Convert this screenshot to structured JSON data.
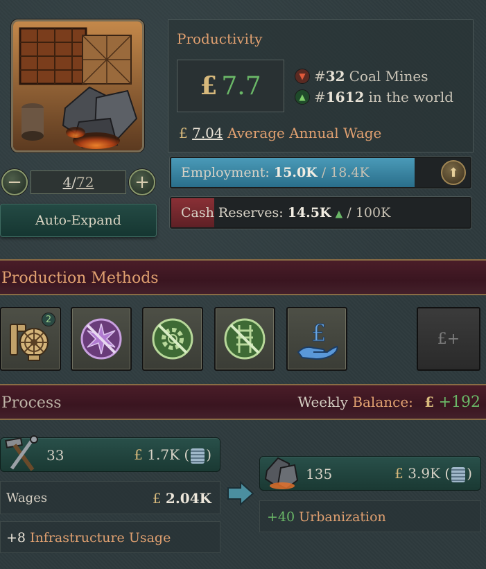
{
  "building": {
    "level_current": "4",
    "level_max": "72",
    "auto_expand_label": "Auto-Expand"
  },
  "productivity": {
    "title": "Productivity",
    "currency_symbol": "£",
    "value": "7.7",
    "rank_industry_prefix": "#",
    "rank_industry": "32",
    "rank_industry_label": "Coal Mines",
    "rank_world_prefix": "#",
    "rank_world": "1612",
    "rank_world_label": "in the world",
    "wage_value": "7.04",
    "wage_label": "Average Annual Wage"
  },
  "employment": {
    "label": "Employment:",
    "current": "15.0K",
    "max": "/ 18.4K",
    "fill_fraction": 0.815
  },
  "cash": {
    "label": "Cash Reserves:",
    "current": "14.5K",
    "max": "/ 100K",
    "fill_fraction": 0.145
  },
  "production_methods": {
    "title": "Production Methods",
    "first_badge": "2",
    "add_label": "£+"
  },
  "process": {
    "title": "Process",
    "balance_word1": "Weekly",
    "balance_word2": "Balance:",
    "balance_value": "+192",
    "input_qty": "33",
    "input_cost": "1.7K",
    "wages_label": "Wages",
    "wages_value": "2.04K",
    "infra_value": "+8",
    "infra_label": "Infrastructure Usage",
    "output_qty": "135",
    "output_value": "3.9K",
    "urban_value": "+40",
    "urban_label": "Urbanization"
  },
  "colors": {
    "positive": "#6ab767",
    "accent_orange": "#e0a070",
    "gold": "#d7b97c",
    "employment_fill": "#3a87a5",
    "cash_fill": "#7a2b30"
  }
}
